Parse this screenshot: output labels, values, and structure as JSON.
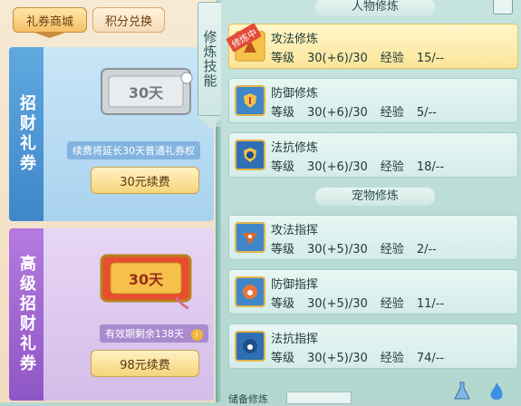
{
  "left_tabs": {
    "coupon_shop": "礼券商城",
    "points_exchange": "积分兑换"
  },
  "cards": {
    "basic": {
      "title": "招财礼券",
      "ticket_label": "30天",
      "info": "续费将延长30天普通礼券权",
      "button": "30元续费"
    },
    "premium": {
      "title": "高级招财礼券",
      "ticket_label": "30天",
      "info": "有效期剩余138天",
      "button": "98元续费"
    }
  },
  "banner": {
    "label": "修炼技能"
  },
  "sections": {
    "character": "人物修炼",
    "pet": "宠物修炼"
  },
  "labels": {
    "level": "等级",
    "exp": "经验"
  },
  "character_skills": [
    {
      "name": "攻法修炼",
      "level": "30(+6)/30",
      "exp": "15/--",
      "active": true,
      "badge": "修炼中"
    },
    {
      "name": "防御修炼",
      "level": "30(+6)/30",
      "exp": "5/--",
      "active": false
    },
    {
      "name": "法抗修炼",
      "level": "30(+6)/30",
      "exp": "18/--",
      "active": false
    }
  ],
  "pet_skills": [
    {
      "name": "攻法指挥",
      "level": "30(+5)/30",
      "exp": "2/--"
    },
    {
      "name": "防御指挥",
      "level": "30(+5)/30",
      "exp": "11/--"
    },
    {
      "name": "法抗指挥",
      "level": "30(+5)/30",
      "exp": "74/--"
    }
  ],
  "bottom": {
    "label": "储备修炼"
  },
  "colors": {
    "accent_gold": "#f6d47a",
    "blue_card": "#a9d2ee",
    "purple_card": "#d4bde8",
    "teal_panel": "#b1d7cf"
  }
}
